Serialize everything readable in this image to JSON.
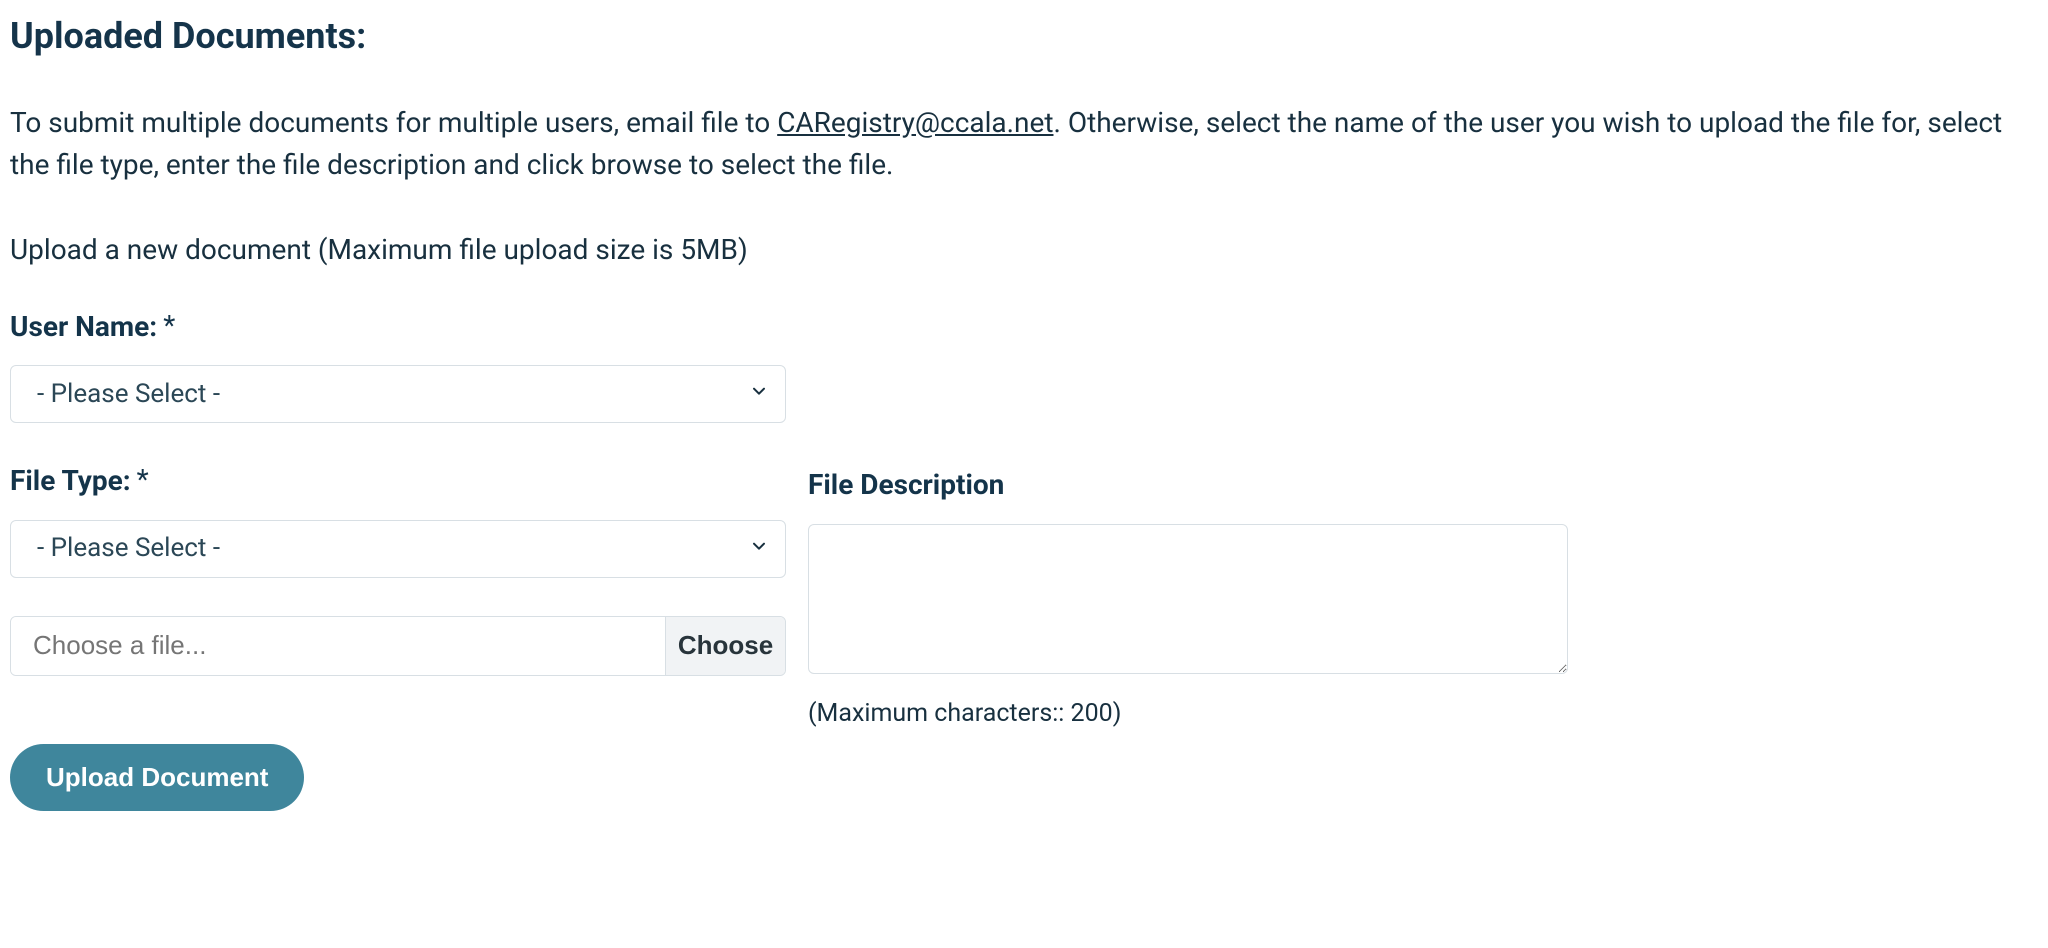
{
  "heading": "Uploaded Documents:",
  "intro": {
    "before": "To submit multiple documents for multiple users, email file to ",
    "email": "CARegistry@ccala.net",
    "after": ". Otherwise, select the name of the user you wish to upload the file for, select the file type, enter the file description and click browse to select the file."
  },
  "upload_hint": "Upload a new document (Maximum file upload size is 5MB)",
  "labels": {
    "user_name": "User Name:",
    "file_type": "File Type:",
    "file_description": "File Description",
    "required_mark": "*"
  },
  "select": {
    "user_name_placeholder": " - Please Select - ",
    "file_type_placeholder": " - Please Select - "
  },
  "file": {
    "placeholder": "Choose a file...",
    "choose_label": "Choose"
  },
  "description": {
    "max_chars_text": "(Maximum characters:: 200)"
  },
  "buttons": {
    "upload": "Upload Document"
  }
}
